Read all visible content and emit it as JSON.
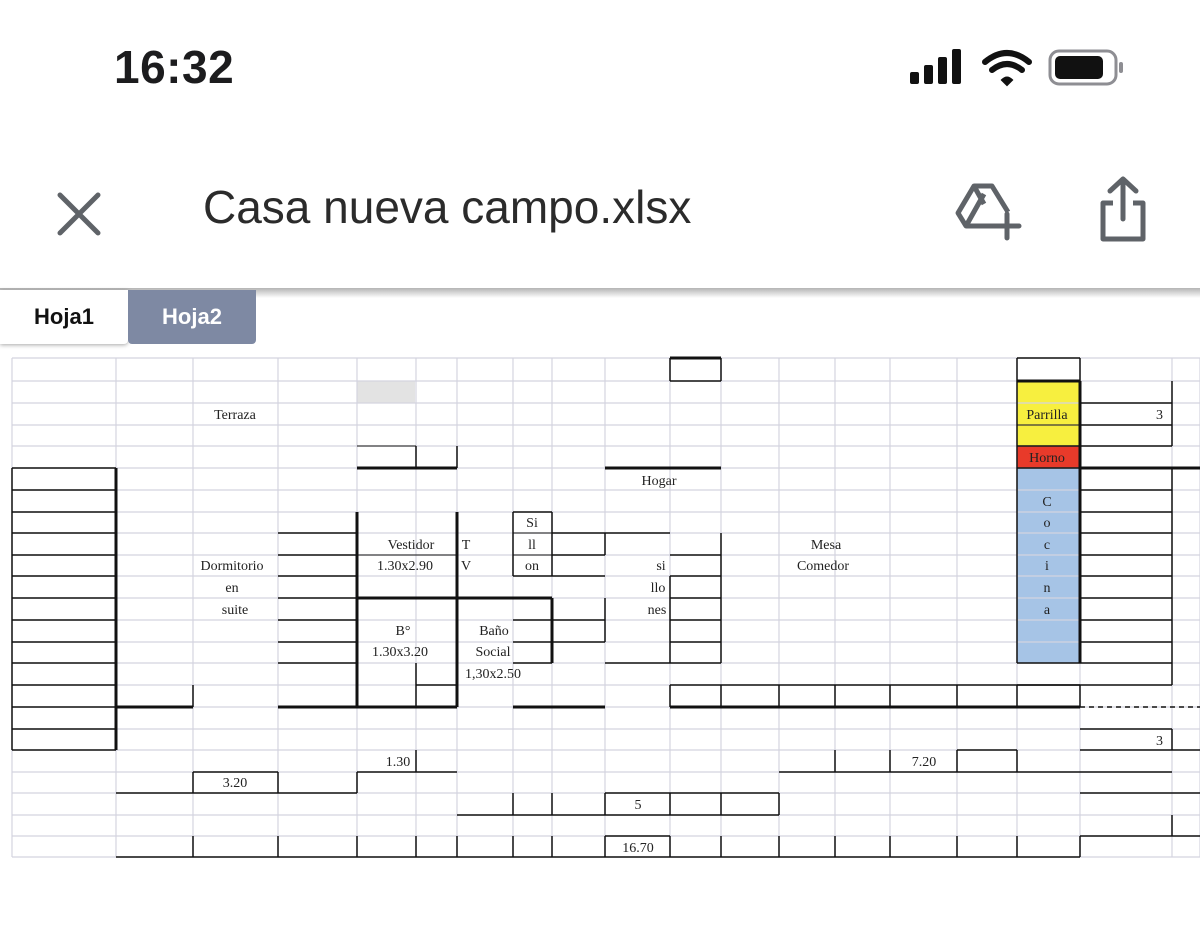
{
  "status_bar": {
    "time": "16:32",
    "icons": [
      "signal-bars-icon",
      "wifi-icon",
      "battery-icon"
    ]
  },
  "app_bar": {
    "file_name": "Casa nueva campo.xlsx",
    "close_icon": "close-icon",
    "drive_icon": "add-to-drive-icon",
    "share_icon": "share-icon"
  },
  "sheet_tabs": [
    {
      "label": "Hoja1",
      "active": true
    },
    {
      "label": "Hoja2",
      "active": false
    }
  ],
  "colors": {
    "tab_inactive": "#7e89a3",
    "grid": "#d4d4df",
    "parrilla": "#f7ef3f",
    "horno": "#e83a2a",
    "cocina": "#a6c4e6",
    "placeholder_cell": "#e3e3e3"
  },
  "cells": [
    {
      "text": "Terraza"
    },
    {
      "text": "Parrilla"
    },
    {
      "text": "3"
    },
    {
      "text": "Horno"
    },
    {
      "text": "Hogar"
    },
    {
      "text": "C"
    },
    {
      "text": "Si"
    },
    {
      "text": "o"
    },
    {
      "text": "Vestidor"
    },
    {
      "text": "T"
    },
    {
      "text": "ll"
    },
    {
      "text": "Mesa"
    },
    {
      "text": "c"
    },
    {
      "text": "Dormitorio"
    },
    {
      "text": "1.30x2.90"
    },
    {
      "text": "V"
    },
    {
      "text": "on"
    },
    {
      "text": "si"
    },
    {
      "text": "Comedor"
    },
    {
      "text": "i"
    },
    {
      "text": "en"
    },
    {
      "text": "llo"
    },
    {
      "text": "n"
    },
    {
      "text": "suite"
    },
    {
      "text": "nes"
    },
    {
      "text": "a"
    },
    {
      "text": "B°"
    },
    {
      "text": "Baño"
    },
    {
      "text": "1.30x3.20"
    },
    {
      "text": "Social"
    },
    {
      "text": "1,30x2.50"
    },
    {
      "text": "3"
    },
    {
      "text": "1.30"
    },
    {
      "text": "7.20"
    },
    {
      "text": "3.20"
    },
    {
      "text": "5"
    },
    {
      "text": "16.70"
    }
  ]
}
